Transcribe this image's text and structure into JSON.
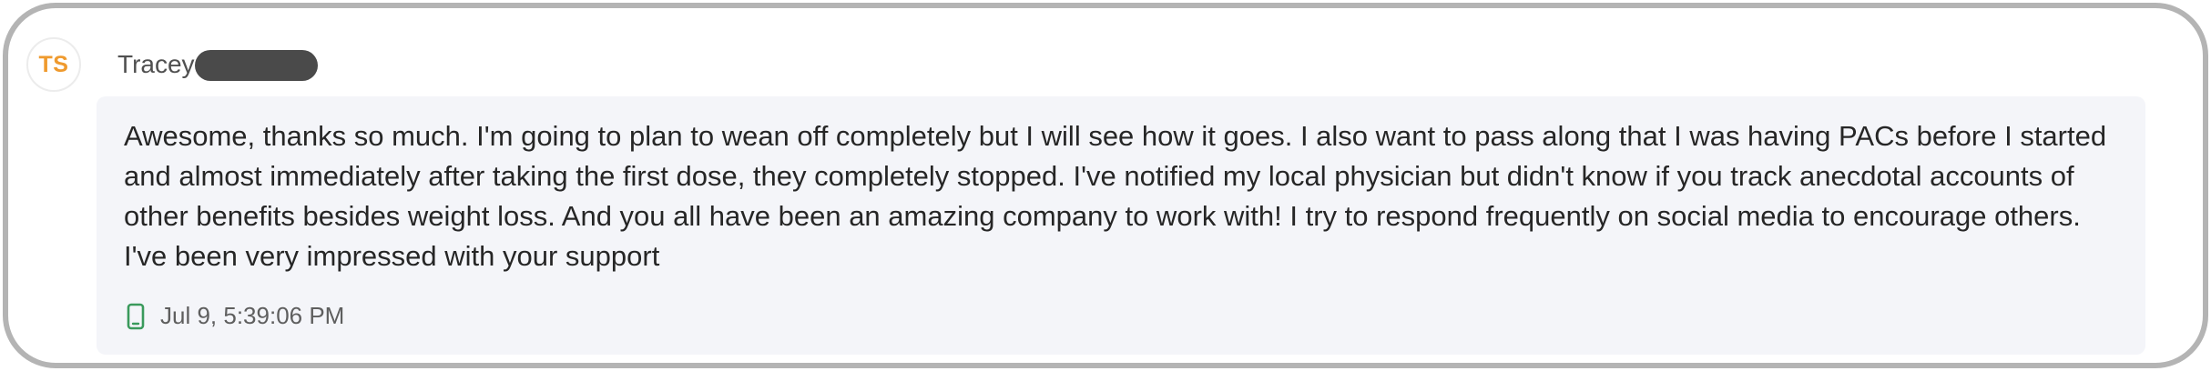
{
  "sender": {
    "initials": "TS",
    "name": "Tracey"
  },
  "message": {
    "text": "Awesome, thanks so much. I'm going to plan to wean off completely but I will see how it goes. I also want to pass along that I was having PACs before I started and almost immediately after taking the first dose, they completely stopped. I've notified my local physician but didn't know if you track anecdotal accounts of other benefits besides weight loss. And you all have been an amazing company to work with! I try to respond frequently on social media to encourage others. I've been very impressed with your support",
    "timestamp": "Jul 9, 5:39:06 PM",
    "channel_icon": "mobile-phone-icon"
  },
  "colors": {
    "avatar_initials": "#ef9a2e",
    "bubble_background": "#f4f5f9",
    "channel_icon": "#3a9a5c",
    "redaction": "#4a4a4a"
  }
}
